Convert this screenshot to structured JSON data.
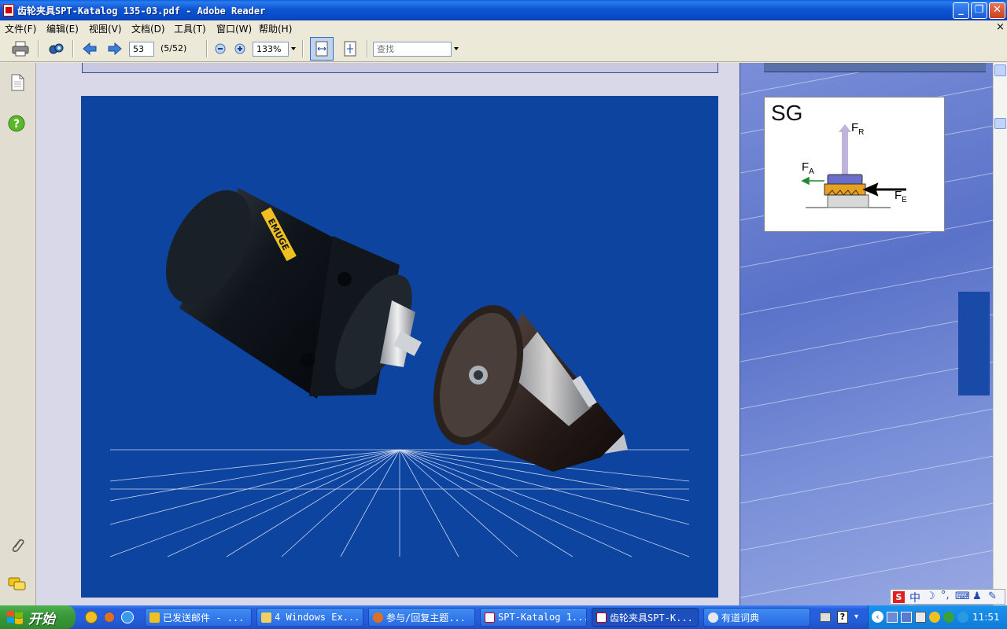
{
  "window": {
    "title": "齿轮夹具SPT-Katalog 135-03.pdf - Adobe Reader",
    "minimize": "_",
    "maximize": "❐",
    "close": "✕"
  },
  "menu": {
    "items": [
      "文件(F)",
      "编辑(E)",
      "视图(V)",
      "文档(D)",
      "工具(T)",
      "窗口(W)",
      "帮助(H)"
    ],
    "close_glyph": "×"
  },
  "toolbar": {
    "page_number": "53",
    "page_count": "(5/52)",
    "zoom": "133%",
    "search_placeholder": "查找"
  },
  "diagram": {
    "title": "SG",
    "force_radial": "F",
    "force_radial_sub": "R",
    "force_axial": "F",
    "force_axial_sub": "A",
    "force_external": "F",
    "force_external_sub": "E"
  },
  "product": {
    "brand_label": "EMUGE"
  },
  "taskbar": {
    "start_label": "开始",
    "tasks": [
      "已发送邮件 - ...",
      "4 Windows Ex...",
      "参与/回复主题...",
      "SPT-Katalog 1...",
      "齿轮夹具SPT-K...",
      "有道词典"
    ],
    "clock": "11:51",
    "ime_label": "中"
  },
  "colors": {
    "page_blue": "#0c44a0",
    "accent_orange": "#e8a020",
    "arrow_green": "#1a8a2a",
    "arrow_lavender": "#b8a8d8"
  }
}
